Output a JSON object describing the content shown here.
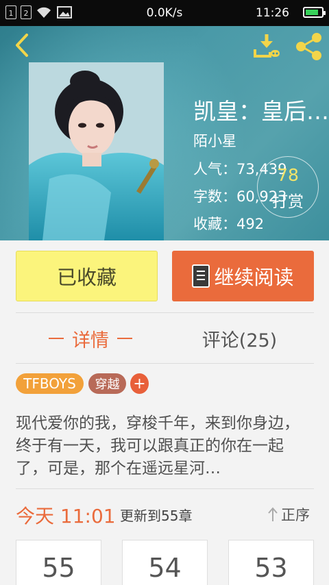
{
  "status_bar": {
    "sim1": "1",
    "sim2": "2",
    "speed": "0.0K/s",
    "time": "11:26",
    "icons": [
      "sim-icon",
      "wifi-icon",
      "image-icon",
      "battery-icon"
    ]
  },
  "header": {
    "back_icon": "chevron-left-icon",
    "download_icon": "download-icon",
    "share_icon": "share-icon",
    "accent_color": "#f2d54a"
  },
  "book": {
    "title": "凯皇：皇后…",
    "author": "陌小星",
    "stats": {
      "popularity_label": "人气：",
      "popularity": "73,439",
      "words_label": "字数：",
      "words": "60,923",
      "favorites_label": "收藏：",
      "favorites": "492"
    },
    "reward": {
      "count": "78",
      "label": "打赏"
    }
  },
  "actions": {
    "favorited_label": "已收藏",
    "continue_label": "继续阅读"
  },
  "tabs": [
    {
      "label": "详情",
      "active": true
    },
    {
      "label": "评论(25)",
      "active": false
    }
  ],
  "tags": [
    "TFBOYS",
    "穿越",
    "+"
  ],
  "description": "现代爱你的我，穿梭千年，来到你身边，终于有一天，我可以跟真正的你在一起了，可是，那个在遥远星河…",
  "update": {
    "time": "今天 11:01",
    "text": "更新到55章",
    "sort_label": "正序"
  },
  "chapters": [
    "55",
    "54",
    "53"
  ],
  "colors": {
    "primary_orange": "#ea6b3c",
    "fav_yellow": "#fbf47c",
    "tag_orange": "#f2a13a",
    "tag_brown": "#b86a58"
  }
}
